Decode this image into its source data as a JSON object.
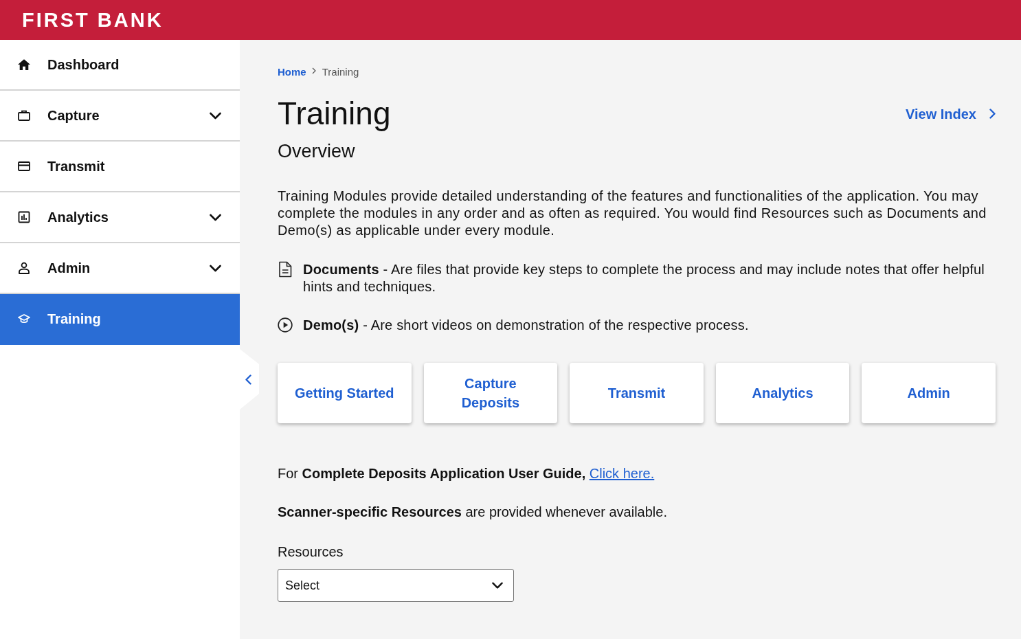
{
  "header": {
    "brand": "FIRST BANK"
  },
  "sidebar": {
    "items": [
      {
        "label": "Dashboard",
        "has_submenu": false,
        "selected": false
      },
      {
        "label": "Capture",
        "has_submenu": true,
        "selected": false
      },
      {
        "label": "Transmit",
        "has_submenu": false,
        "selected": false
      },
      {
        "label": "Analytics",
        "has_submenu": true,
        "selected": false
      },
      {
        "label": "Admin",
        "has_submenu": true,
        "selected": false
      },
      {
        "label": "Training",
        "has_submenu": false,
        "selected": true
      }
    ]
  },
  "breadcrumb": [
    {
      "label": "Home",
      "current": false
    },
    {
      "label": "Training",
      "current": true
    }
  ],
  "page": {
    "title": "Training",
    "subtitle": "Overview",
    "view_index": "View Index"
  },
  "intro": "Training Modules provide detailed understanding of the features and functionalities of the application. You may complete the modules in any order and as often as required. You would find Resources such as Documents and Demo(s) as applicable under every module.",
  "resource_types": [
    {
      "kind": "document",
      "text": "**Documents** - Are files that provide key steps to complete the process and may include notes that offer helpful hints and techniques."
    },
    {
      "kind": "demo",
      "text": "**Demo(s)** - Are short videos on demonstration of the respective process."
    }
  ],
  "modules": [
    "Getting Started",
    "Capture Deposits",
    "Transmit",
    "Analytics",
    "Admin"
  ],
  "guide": {
    "text": "For **Complete Deposits Application User Guide,**",
    "link": "Click here."
  },
  "scanner_note": "**Scanner-specific Resources** are provided whenever available.",
  "resources_field": {
    "label": "Resources",
    "value": "Select"
  }
}
